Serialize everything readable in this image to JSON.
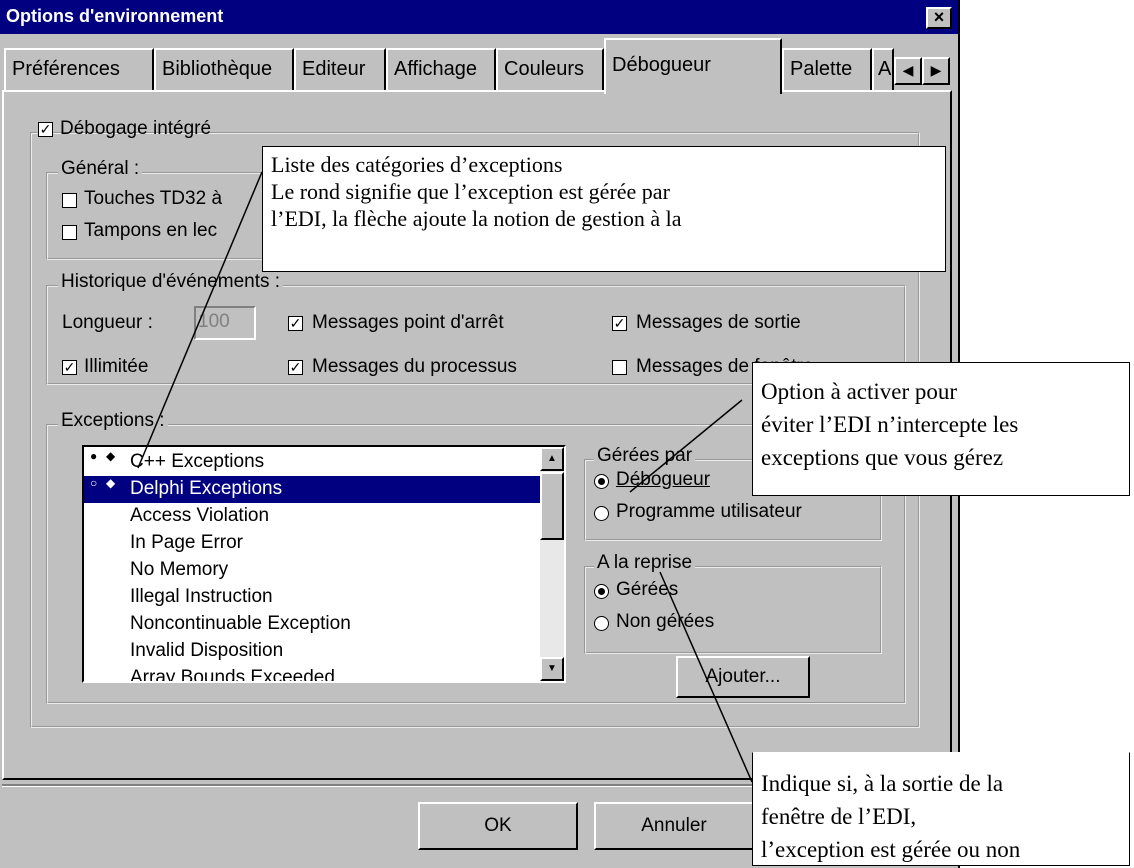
{
  "window": {
    "title": "Options d'environnement",
    "close_glyph": "×"
  },
  "tabs": [
    "Préférences",
    "Bibliothèque",
    "Editeur",
    "Affichage",
    "Couleurs",
    "Débogueur",
    "Palette",
    "A"
  ],
  "active_tab": "Débogueur",
  "integrated_debugging": {
    "label": "Débogage intégré",
    "checked": true
  },
  "general": {
    "title": "Général :",
    "td32_keys": {
      "label": "Touches TD32 à",
      "checked": false
    },
    "buffers": {
      "label": "Tampons en lec",
      "checked": false
    }
  },
  "event_history": {
    "title": "Historique d'événements :",
    "length_label": "Longueur :",
    "length_value": "100",
    "unlimited": {
      "label": "Illimitée",
      "checked": true
    },
    "breakpoint_messages": {
      "label": "Messages point d'arrêt",
      "checked": true
    },
    "process_messages": {
      "label": "Messages du processus",
      "checked": true
    },
    "output_messages": {
      "label": "Messages de sortie",
      "checked": true
    },
    "window_messages": {
      "label": "Messages de fenêtre",
      "checked": false
    }
  },
  "exceptions": {
    "title": "Exceptions :",
    "items": [
      "C++ Exceptions",
      "Delphi Exceptions",
      "Access Violation",
      "In Page Error",
      "No Memory",
      "Illegal Instruction",
      "Noncontinuable Exception",
      "Invalid Disposition",
      "Array Bounds Exceeded"
    ],
    "selected_index": 1
  },
  "handled_by": {
    "title": "Gérées par",
    "debugger": {
      "label": "Débogueur",
      "selected": true
    },
    "user_program": {
      "label": "Programme utilisateur",
      "selected": false
    }
  },
  "on_resume": {
    "title": "A la reprise",
    "handled": {
      "label": "Gérées",
      "selected": true
    },
    "unhandled": {
      "label": "Non gérées",
      "selected": false
    }
  },
  "buttons": {
    "add": "Ajouter...",
    "ok": "OK",
    "cancel": "Annuler"
  },
  "callouts": {
    "categories": [
      "Liste des catégories d’exceptions",
      "Le rond signifie que l’exception est gérée par",
      "l’EDI, la flèche ajoute la notion de gestion à la"
    ],
    "option": [
      "Option à activer pour",
      "éviter l’EDI n’intercepte les",
      "exceptions que vous gérez"
    ],
    "resume": [
      "Indique si, à la sortie de la",
      "fenêtre de l’EDI,",
      "l’exception est gérée ou non"
    ]
  }
}
